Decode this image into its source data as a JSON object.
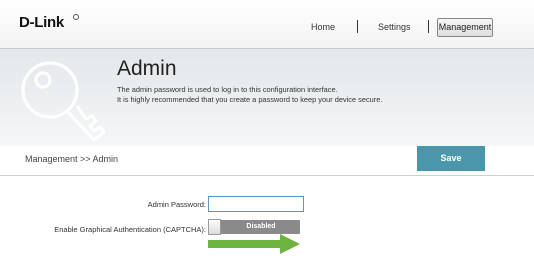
{
  "brand": {
    "logo_text": "D-Link"
  },
  "nav": {
    "items": [
      {
        "label": "Home"
      },
      {
        "label": "Settings"
      },
      {
        "label": "Management"
      }
    ]
  },
  "header": {
    "title": "Admin",
    "description_lines": [
      "The admin password is used to log in to this configuration interface.",
      "It is highly recommended that you create a password to keep your device secure."
    ]
  },
  "breadcrumb": "Management >> Admin",
  "actions": {
    "save_label": "Save"
  },
  "form": {
    "admin_password_label": "Admin Password:",
    "admin_password_value": "",
    "captcha_label": "Enable Graphical Authentication (CAPTCHA):",
    "captcha_state": "Disabled"
  },
  "colors": {
    "accent": "#4a97ab",
    "arrow": "#6db33f",
    "input_border": "#5b96c9",
    "toggle_off": "#8a8a8a"
  },
  "icons": {
    "header_icon": "key-icon",
    "annotation": "arrow-right-icon"
  }
}
